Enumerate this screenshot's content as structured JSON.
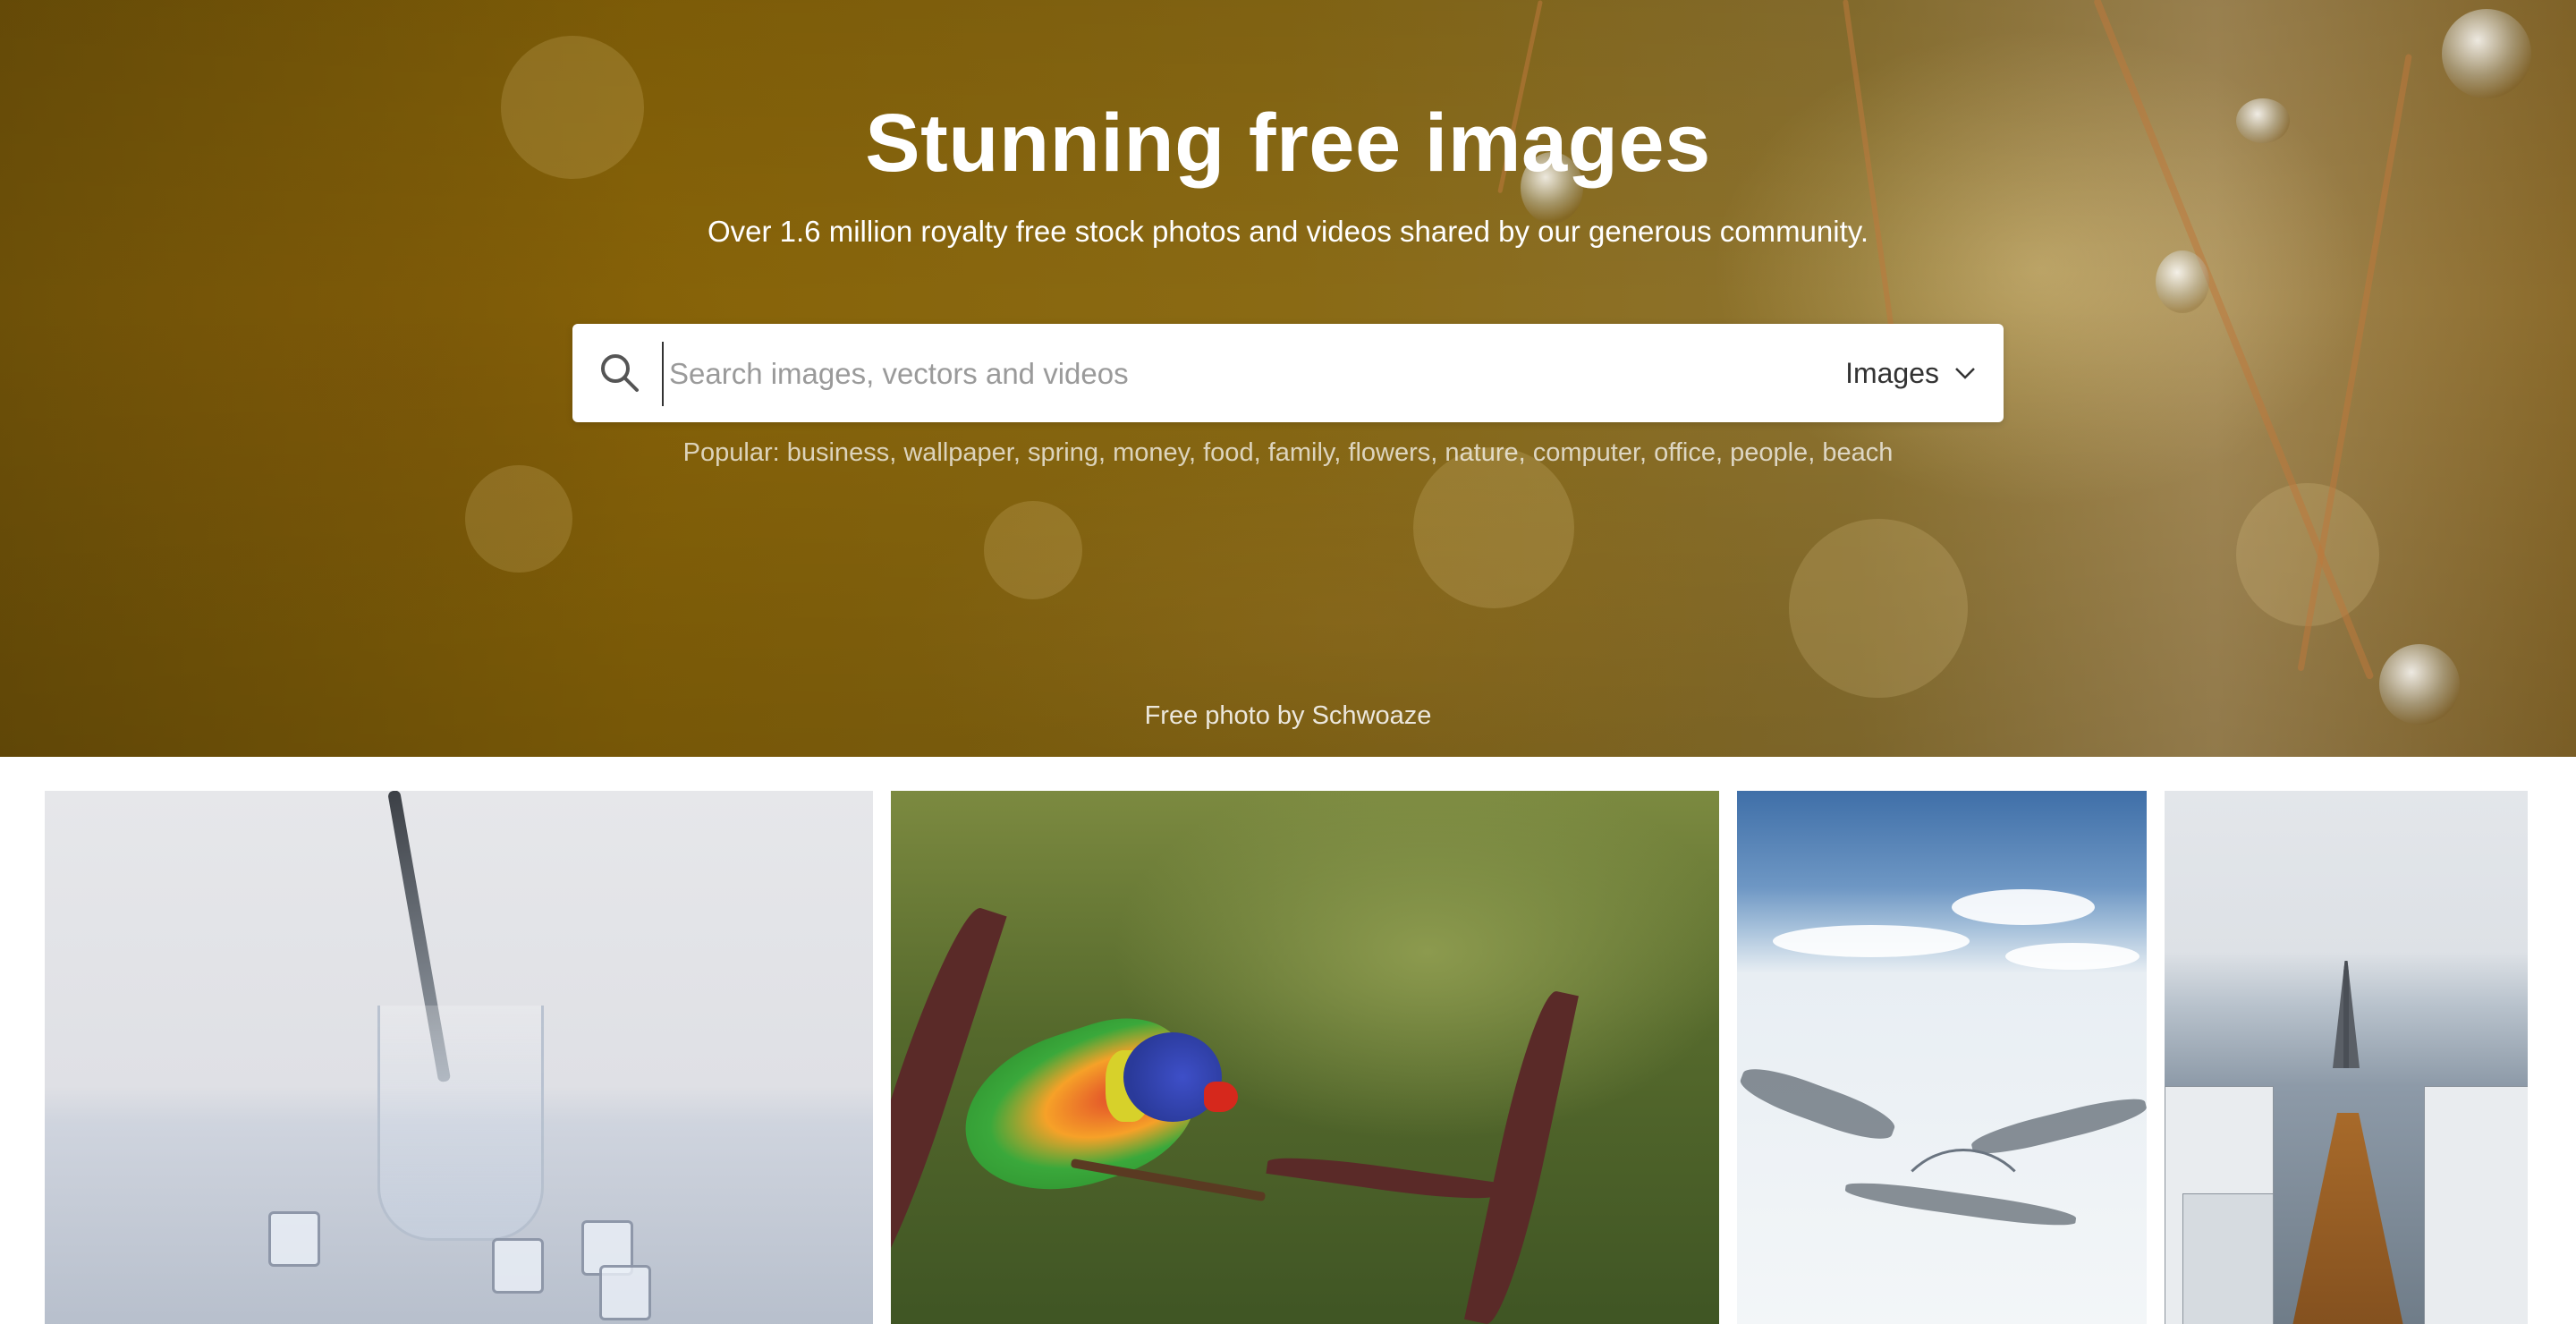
{
  "hero": {
    "title": "Stunning free images",
    "subtitle": "Over 1.6 million royalty free stock photos and videos shared by our generous community.",
    "search": {
      "placeholder": "Search images, vectors and videos",
      "value": "",
      "type_selected": "Images"
    },
    "popular_label": "Popular:",
    "popular_tags": [
      "business",
      "wallpaper",
      "spring",
      "money",
      "food",
      "family",
      "flowers",
      "nature",
      "computer",
      "office",
      "people",
      "beach"
    ],
    "credit_prefix": "Free photo by",
    "credit_author": "Schwoaze"
  },
  "icons": {
    "search": "search-icon",
    "dropdown": "chevron-down-icon"
  },
  "colors": {
    "hero_tint": "#876308",
    "text_on_hero": "#ffffff",
    "search_bg": "#ffffff",
    "placeholder": "#9a9a9a"
  }
}
